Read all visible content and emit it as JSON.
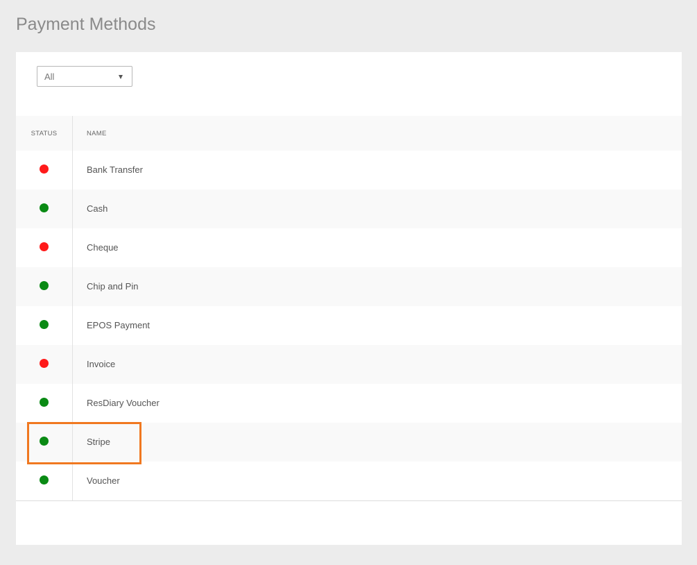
{
  "page": {
    "title": "Payment Methods"
  },
  "filter": {
    "selected": "All",
    "caret_icon": "triangle-down-icon"
  },
  "table": {
    "headers": {
      "status": "STATUS",
      "name": "NAME"
    },
    "rows": [
      {
        "name": "Bank Transfer",
        "status": "inactive"
      },
      {
        "name": "Cash",
        "status": "active"
      },
      {
        "name": "Cheque",
        "status": "inactive"
      },
      {
        "name": "Chip and Pin",
        "status": "active"
      },
      {
        "name": "EPOS Payment",
        "status": "active"
      },
      {
        "name": "Invoice",
        "status": "inactive"
      },
      {
        "name": "ResDiary Voucher",
        "status": "active"
      },
      {
        "name": "Stripe",
        "status": "active"
      },
      {
        "name": "Voucher",
        "status": "active"
      }
    ]
  },
  "colors": {
    "active": "#0a8a14",
    "inactive": "#ff1a1a",
    "highlight": "#f07820"
  }
}
